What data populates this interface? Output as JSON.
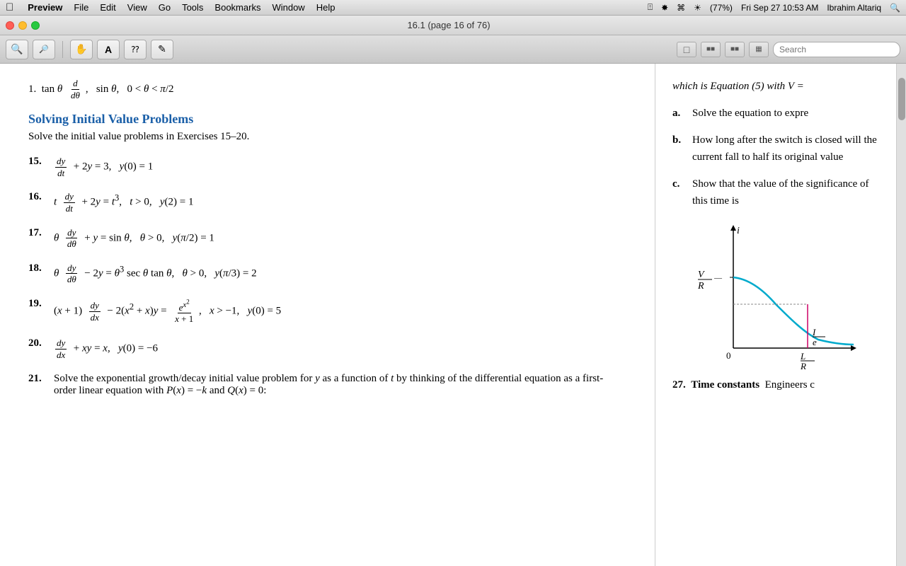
{
  "menubar": {
    "apple": "⌘",
    "items": [
      "Preview",
      "File",
      "Edit",
      "View",
      "Go",
      "Tools",
      "Bookmarks",
      "Window",
      "Help"
    ],
    "right": {
      "battery": "77%",
      "datetime": "Fri Sep 27   10:53 AM",
      "user": "Ibrahim Altariq"
    }
  },
  "titlebar": {
    "title": "16.1 (page 16 of 76)"
  },
  "toolbar": {
    "buttons": [
      "🔍",
      "🔍",
      "✋",
      "A",
      "▦",
      "✏"
    ],
    "view_buttons": [
      "⊡",
      "⊡⊡",
      "⊡⊡",
      "⊞"
    ],
    "search_placeholder": "Search"
  },
  "left_page": {
    "top_formula": "tan θ dθ,   sin θ,   0 < θ < π/2",
    "section_header": "Solving Initial Value Problems",
    "section_intro": "Solve the initial value problems in Exercises 15–20.",
    "problems": [
      {
        "num": "15.",
        "equation": "dy/dt + 2y = 3,   y(0) = 1"
      },
      {
        "num": "16.",
        "equation": "t dy/dt + 2y = t³,   t > 0,   y(2) = 1"
      },
      {
        "num": "17.",
        "equation": "θ dy/dθ + y = sin θ,   θ > 0,   y(π/2) = 1"
      },
      {
        "num": "18.",
        "equation": "θ dy/dθ − 2y = θ³ sec θ tan θ,   θ > 0,   y(π/3) = 2"
      },
      {
        "num": "19.",
        "equation": "(x + 1) dy/dx − 2(x² + x)y = e^(x²)/(x+1),   x > −1,   y(0) = 5"
      },
      {
        "num": "20.",
        "equation": "dy/dx + xy = x,   y(0) = −6"
      }
    ],
    "problem_21": {
      "num": "21.",
      "text": "Solve the exponential growth/decay initial value problem for y as a function of t by thinking of the differential equation as a first-order linear equation with P(x) = −k and Q(x) = 0:"
    }
  },
  "right_page": {
    "top_text": "which is Equation (5) with V =",
    "items": [
      {
        "label": "a.",
        "text": "Solve the equation to expre"
      },
      {
        "label": "b.",
        "text": "How long after the switch is closed will the current fall to half its original value"
      },
      {
        "label": "c.",
        "text": "Show that the value of the significance of this time is"
      }
    ],
    "graph": {
      "y_axis_label": "i",
      "x_axis_label": "",
      "v_label": "V/R",
      "e_label": "I/e",
      "l_label": "L/R",
      "zero_label": "0"
    },
    "problem_27": {
      "num": "27.",
      "bold": "Time constants",
      "text": "Engineers c"
    }
  }
}
